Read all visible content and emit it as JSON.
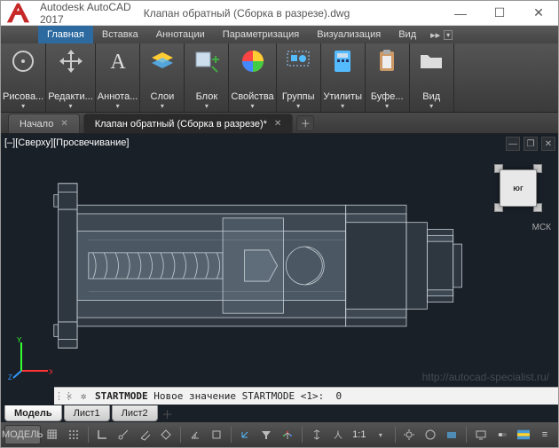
{
  "title": {
    "app": "Autodesk AutoCAD 2017",
    "file": "Клапан обратный (Сборка в разрезе).dwg"
  },
  "menu": {
    "items": [
      "Главная",
      "Вставка",
      "Аннотации",
      "Параметризация",
      "Визуализация",
      "Вид"
    ],
    "active": 0
  },
  "ribbon": [
    {
      "label": "Рисова...",
      "name": "draw-panel"
    },
    {
      "label": "Редакти...",
      "name": "edit-panel"
    },
    {
      "label": "Аннота...",
      "name": "annotate-panel"
    },
    {
      "label": "Слои",
      "name": "layers-panel"
    },
    {
      "label": "Блок",
      "name": "block-panel"
    },
    {
      "label": "Свойства",
      "name": "properties-panel"
    },
    {
      "label": "Группы",
      "name": "groups-panel"
    },
    {
      "label": "Утилиты",
      "name": "utilities-panel"
    },
    {
      "label": "Буфе...",
      "name": "clipboard-panel"
    },
    {
      "label": "Вид",
      "name": "view-panel"
    }
  ],
  "doctabs": {
    "items": [
      {
        "label": "Начало"
      },
      {
        "label": "Клапан обратный (Сборка в разрезе)*"
      }
    ],
    "active": 1
  },
  "viewport": {
    "info": "[–][Сверху][Просвечивание]",
    "cube": "юг",
    "wcs": "МСК"
  },
  "cmd": {
    "name": "STARTMODE",
    "msg": "Новое значение STARTMODE <1>:",
    "val": "0"
  },
  "layouts": {
    "items": [
      "Модель",
      "Лист1",
      "Лист2"
    ],
    "active": 0
  },
  "status": {
    "model": "МОДЕЛЬ",
    "scale": "1:1"
  },
  "watermark": "http://autocad-specialist.ru/"
}
